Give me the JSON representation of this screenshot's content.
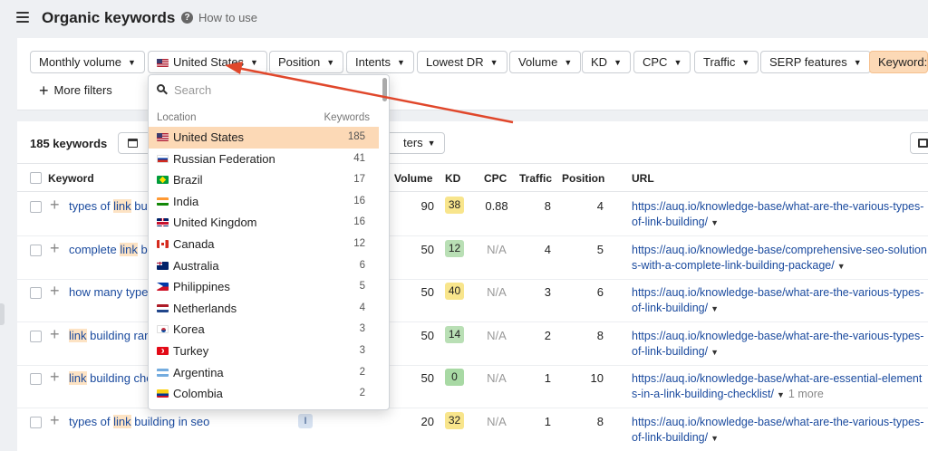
{
  "header": {
    "title": "Organic keywords",
    "help_label": "How to use"
  },
  "filters": {
    "buttons": [
      {
        "label": "Monthly volume"
      },
      {
        "label": "United States",
        "flag": "us"
      },
      {
        "label": "Position"
      },
      {
        "label": "Intents"
      },
      {
        "label": "Lowest DR"
      },
      {
        "label": "Volume"
      },
      {
        "label": "KD"
      },
      {
        "label": "CPC"
      },
      {
        "label": "Traffic"
      },
      {
        "label": "SERP features"
      },
      {
        "label": "Keyword:"
      }
    ],
    "more_filters": "More filters"
  },
  "results": {
    "count_label": "185 keywords",
    "filters_button": "ters",
    "columns": [
      "Keyword",
      "Volume",
      "KD",
      "CPC",
      "Traffic",
      "Position",
      "URL"
    ],
    "rows": [
      {
        "kw_pre": "types of ",
        "kw_hl": "link",
        "kw_post": " bu",
        "intent": "",
        "volume": "90",
        "kd": "38",
        "kd_color": "#f8e58c",
        "cpc": "0.88",
        "traffic": "8",
        "position": "4",
        "url": "https://auq.io/knowledge-base/what-are-the-various-types-of-link-building/",
        "more": ""
      },
      {
        "kw_pre": "complete ",
        "kw_hl": "link",
        "kw_post": " b",
        "intent": "",
        "volume": "50",
        "kd": "12",
        "kd_color": "#b9dfb5",
        "cpc": "N/A",
        "traffic": "4",
        "position": "5",
        "url": "https://auq.io/knowledge-base/comprehensive-seo-solutions-with-a-complete-link-building-package/",
        "more": ""
      },
      {
        "kw_pre": "how many type",
        "kw_hl": "",
        "kw_post": "",
        "intent": "",
        "volume": "50",
        "kd": "40",
        "kd_color": "#f8e58c",
        "cpc": "N/A",
        "traffic": "3",
        "position": "6",
        "url": "https://auq.io/knowledge-base/what-are-the-various-types-of-link-building/",
        "more": ""
      },
      {
        "kw_pre": "",
        "kw_hl": "link",
        "kw_post": " building ran",
        "intent": "",
        "volume": "50",
        "kd": "14",
        "kd_color": "#b9dfb5",
        "cpc": "N/A",
        "traffic": "2",
        "position": "8",
        "url": "https://auq.io/knowledge-base/what-are-the-various-types-of-link-building/",
        "more": ""
      },
      {
        "kw_pre": "",
        "kw_hl": "link",
        "kw_post": " building che",
        "intent": "",
        "volume": "50",
        "kd": "0",
        "kd_color": "#a8d9a4",
        "cpc": "N/A",
        "traffic": "1",
        "position": "10",
        "url": "https://auq.io/knowledge-base/what-are-essential-elements-in-a-link-building-checklist/",
        "more": "1 more"
      },
      {
        "kw_pre": "types of ",
        "kw_hl": "link",
        "kw_post": " building in seo",
        "intent": "I",
        "volume": "20",
        "kd": "32",
        "kd_color": "#f8e58c",
        "cpc": "N/A",
        "traffic": "1",
        "position": "8",
        "url": "https://auq.io/knowledge-base/what-are-the-various-types-of-link-building/",
        "more": ""
      }
    ]
  },
  "location_dropdown": {
    "search_placeholder": "Search",
    "col_location": "Location",
    "col_keywords": "Keywords",
    "items": [
      {
        "name": "United States",
        "count": "185",
        "flag": "us",
        "selected": true
      },
      {
        "name": "Russian Federation",
        "count": "41",
        "flag": "ru"
      },
      {
        "name": "Brazil",
        "count": "17",
        "flag": "br"
      },
      {
        "name": "India",
        "count": "16",
        "flag": "in"
      },
      {
        "name": "United Kingdom",
        "count": "16",
        "flag": "gb"
      },
      {
        "name": "Canada",
        "count": "12",
        "flag": "ca"
      },
      {
        "name": "Australia",
        "count": "6",
        "flag": "au"
      },
      {
        "name": "Philippines",
        "count": "5",
        "flag": "ph"
      },
      {
        "name": "Netherlands",
        "count": "4",
        "flag": "nl"
      },
      {
        "name": "Korea",
        "count": "3",
        "flag": "kr"
      },
      {
        "name": "Turkey",
        "count": "3",
        "flag": "tr"
      },
      {
        "name": "Argentina",
        "count": "2",
        "flag": "ar"
      },
      {
        "name": "Colombia",
        "count": "2",
        "flag": "co"
      },
      {
        "name": "",
        "count": "",
        "flag": "xx"
      }
    ]
  },
  "colors": {
    "selected_bg": "#fcd9b6",
    "link": "#1a4a9e",
    "annotation_arrow": "#e0472b"
  }
}
